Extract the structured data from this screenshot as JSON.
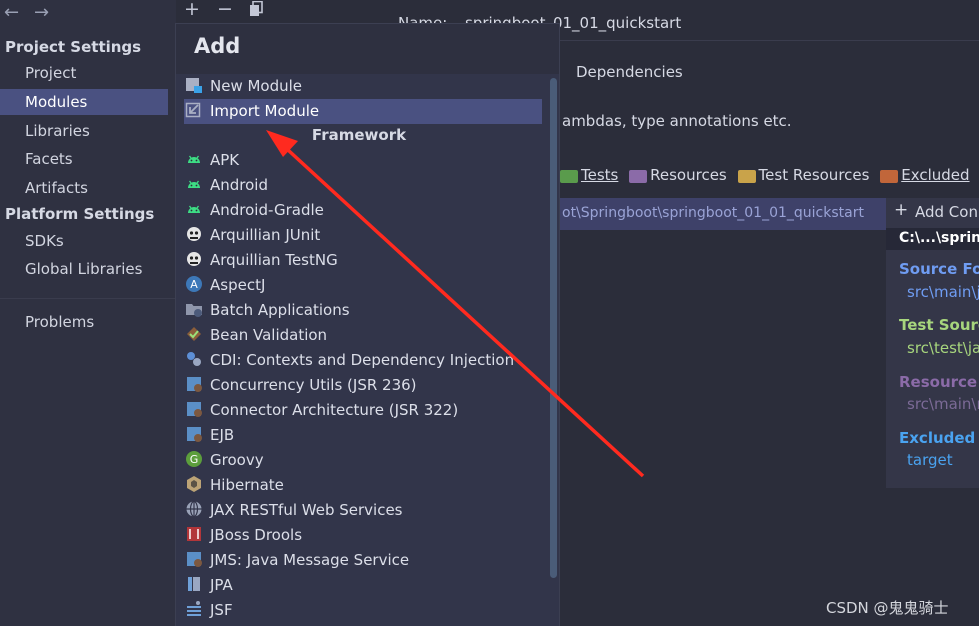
{
  "sidebar": {
    "project_settings": "Project Settings",
    "project_items": [
      "Project",
      "Modules",
      "Libraries",
      "Facets",
      "Artifacts"
    ],
    "selected": "Modules",
    "platform_settings": "Platform Settings",
    "platform_items": [
      "SDKs",
      "Global Libraries"
    ],
    "problems": "Problems"
  },
  "content": {
    "name_label": "Name:",
    "module_name": "springboot_01_01_quickstart",
    "dependencies_tab": "Dependencies",
    "lambda_text": "ambdas, type annotations etc.",
    "marks": {
      "tests": "Tests",
      "resources": "Resources",
      "test_resources": "Test Resources",
      "excluded": "Excluded"
    },
    "content_root_path": "ot\\Springboot\\springboot_01_01_quickstart",
    "add_content_root": "Add Con",
    "root_path": "C:\\...\\spring",
    "source_folders": "Source Fol",
    "source_path": "src\\main\\j",
    "test_source": "Test Source",
    "test_path": "src\\test\\ja",
    "resource_folders": "Resource F",
    "resource_path": "src\\main\\r",
    "excluded_folders": "Excluded F",
    "excluded_path": "target"
  },
  "popup": {
    "title": "Add",
    "top_items": [
      "New Module",
      "Import Module"
    ],
    "selected": "Import Module",
    "framework_label": "Framework",
    "framework_items": [
      "APK",
      "Android",
      "Android-Gradle",
      "Arquillian JUnit",
      "Arquillian TestNG",
      "AspectJ",
      "Batch Applications",
      "Bean Validation",
      "CDI: Contexts and Dependency Injection",
      "Concurrency Utils (JSR 236)",
      "Connector Architecture (JSR 322)",
      "EJB",
      "Groovy",
      "Hibernate",
      "JAX RESTful Web Services",
      "JBoss Drools",
      "JMS: Java Message Service",
      "JPA",
      "JSF"
    ]
  },
  "watermark": "CSDN @鬼鬼骑士",
  "colors": {
    "selection": "#4a5181",
    "arrow": "#ff2a1f",
    "source": "#6f9cf2",
    "test": "#a7d67d",
    "resource": "#8b6ba8",
    "excluded": "#4aa3f0"
  }
}
